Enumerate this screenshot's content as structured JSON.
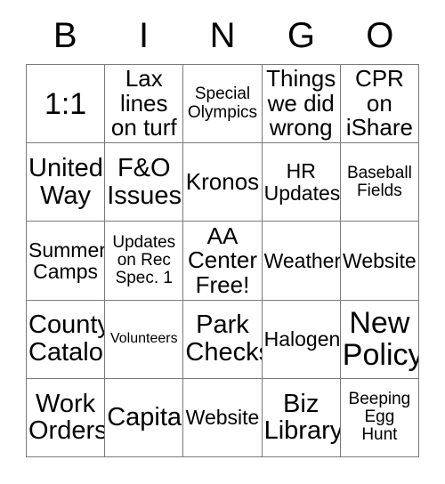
{
  "card": {
    "title_letters": [
      "B",
      "I",
      "N",
      "G",
      "O"
    ],
    "grid_size": "5x5",
    "text_color": "#000000",
    "border_color": "#7a7a7a",
    "background_color": "#ffffff",
    "rows": [
      [
        {
          "text": "1:1",
          "size": "xxl"
        },
        {
          "text": "Lax\nlines\non turf",
          "size": "lg"
        },
        {
          "text": "Special\nOlympics",
          "size": "sm"
        },
        {
          "text": "Things\nwe did\nwrong",
          "size": "lg"
        },
        {
          "text": "CPR\non\niShare",
          "size": "lg"
        }
      ],
      [
        {
          "text": "United\nWay",
          "size": "xl"
        },
        {
          "text": "F&O\nIssues",
          "size": "xl"
        },
        {
          "text": "Kronos",
          "size": "lg"
        },
        {
          "text": "HR\nUpdates",
          "size": "md"
        },
        {
          "text": "Baseball\nFields",
          "size": "sm"
        }
      ],
      [
        {
          "text": "Summer\nCamps",
          "size": "md"
        },
        {
          "text": "Updates\non Rec\nSpec. 1",
          "size": "sm"
        },
        {
          "text": "AA\nCenter\nFree!",
          "size": "lg"
        },
        {
          "text": "Weather",
          "size": "md"
        },
        {
          "text": "Website",
          "size": "md"
        }
      ],
      [
        {
          "text": "County\nCatalog",
          "size": "xl"
        },
        {
          "text": "Volunteers",
          "size": "xs"
        },
        {
          "text": "Park\nChecks",
          "size": "xl"
        },
        {
          "text": "Halogen",
          "size": "md"
        },
        {
          "text": "New\nPolicy",
          "size": "xxl"
        }
      ],
      [
        {
          "text": "Work\nOrders",
          "size": "xl"
        },
        {
          "text": "Capital",
          "size": "xl"
        },
        {
          "text": "Website",
          "size": "md"
        },
        {
          "text": "Biz\nLibrary",
          "size": "xl"
        },
        {
          "text": "Beeping\nEgg\nHunt",
          "size": "sm"
        }
      ]
    ]
  }
}
